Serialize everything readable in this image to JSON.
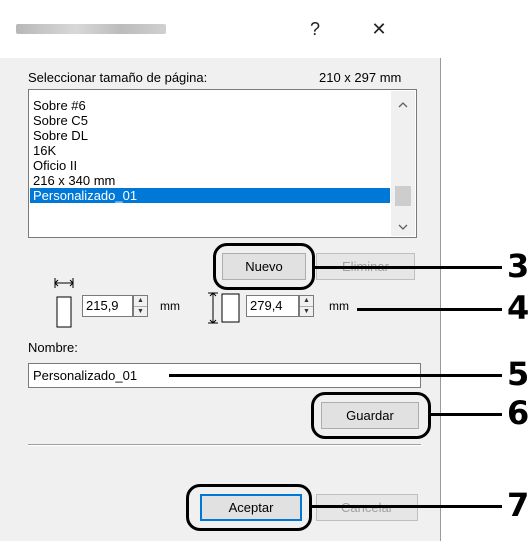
{
  "titlebar": {
    "help_label": "?",
    "close_label": "✕"
  },
  "page_size": {
    "label": "Seleccionar tamaño de página:",
    "current_size": "210 x 297 mm",
    "items": [
      "Sobre #6",
      "Sobre C5",
      "Sobre DL",
      "16K",
      "Oficio II",
      "216 x 340 mm",
      "Personalizado_01"
    ],
    "selected_index": 6
  },
  "buttons": {
    "new_label": "Nuevo",
    "delete_label": "Eliminar",
    "save_label": "Guardar",
    "accept_label": "Aceptar",
    "cancel_label": "Cancelar"
  },
  "dimensions": {
    "width_value": "215,9",
    "width_unit": "mm",
    "height_value": "279,4",
    "height_unit": "mm"
  },
  "name_field": {
    "label": "Nombre:",
    "value": "Personalizado_01"
  },
  "callouts": [
    "3",
    "4",
    "5",
    "6",
    "7"
  ],
  "colors": {
    "selection": "#0078d7",
    "dialog_bg": "#f0f0f0"
  }
}
